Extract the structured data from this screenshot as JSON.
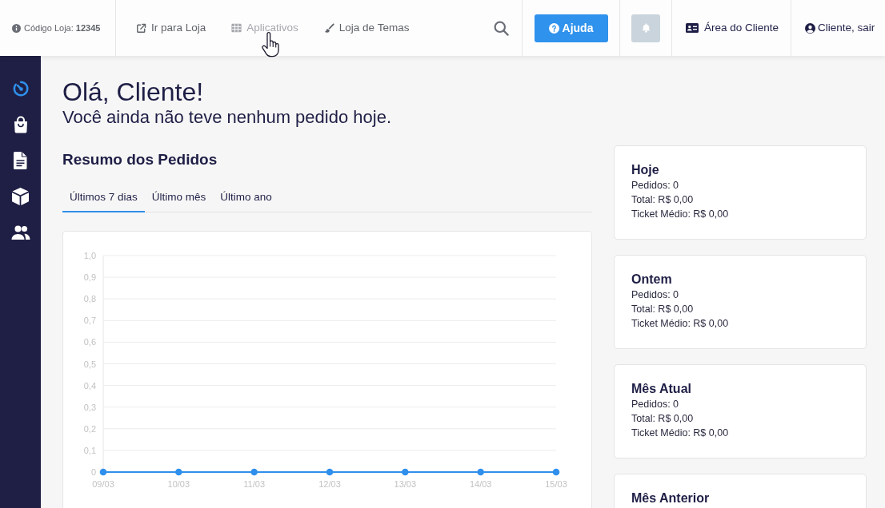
{
  "top_bar": {
    "store_code": "Código Loja: **12345**",
    "nav_links": [
      {
        "kind": "external",
        "label": "Ir para Loja",
        "hovered": false
      },
      {
        "kind": "apps",
        "label": "Aplicativos",
        "hovered": true
      },
      {
        "kind": "themes",
        "label": "Loja de Temas",
        "hovered": false
      }
    ],
    "help_button": {
      "label": "Ajuda"
    },
    "client_area": {
      "label": "Área do Cliente"
    },
    "account": {
      "label": "Cliente, sair"
    }
  },
  "sidebar": {
    "items": [
      {
        "kind": "stopwatch",
        "selected": true
      },
      {
        "kind": "bag",
        "selected": false
      },
      {
        "kind": "document",
        "selected": false
      },
      {
        "kind": "cube",
        "selected": false
      },
      {
        "kind": "people",
        "selected": false
      }
    ]
  },
  "greeting": {
    "title": "Olá, Cliente!",
    "subtitle": "Você ainda não teve nenhum pedido hoje."
  },
  "orders_summary": {
    "title": "Resumo dos Pedidos",
    "tabs": [
      {
        "label": "Últimos 7 dias",
        "selected": true
      },
      {
        "label": "Último mês",
        "selected": false
      },
      {
        "label": "Último ano",
        "selected": false
      }
    ],
    "chart_data": {
      "type": "line",
      "grid": true,
      "categories": [
        "09/03",
        "10/03",
        "11/03",
        "12/03",
        "13/03",
        "14/03",
        "15/03"
      ],
      "series": [
        {
          "color": "#2f8fec",
          "marker": "circle",
          "values": [
            0,
            0,
            0,
            0,
            0,
            0,
            0
          ]
        }
      ],
      "ylim": [
        0,
        1
      ],
      "yticks": [
        {
          "value": 0,
          "label": "0"
        },
        {
          "value": 0.1,
          "label": "0,1"
        },
        {
          "value": 0.2,
          "label": "0,2"
        },
        {
          "value": 0.3,
          "label": "0,3"
        },
        {
          "value": 0.4,
          "label": "0,4"
        },
        {
          "value": 0.5,
          "label": "0,5"
        },
        {
          "value": 0.6,
          "label": "0,6"
        },
        {
          "value": 0.7,
          "label": "0,7"
        },
        {
          "value": 0.8,
          "label": "0,8"
        },
        {
          "value": 0.9,
          "label": "0,9"
        },
        {
          "value": 1,
          "label": "1,0"
        }
      ]
    }
  },
  "summary_cards": [
    {
      "title": "Hoje",
      "lines": [
        "Pedidos: 0",
        "Total: R$ 0,00",
        "Ticket Médio: R$ 0,00"
      ]
    },
    {
      "title": "Ontem",
      "lines": [
        "Pedidos: 0",
        "Total: R$ 0,00",
        "Ticket Médio: R$ 0,00"
      ]
    },
    {
      "title": "Mês Atual",
      "lines": [
        "Pedidos: 0",
        "Total: R$ 0,00",
        "Ticket Médio: R$ 0,00"
      ]
    },
    {
      "title": "Mês Anterior"
    }
  ]
}
